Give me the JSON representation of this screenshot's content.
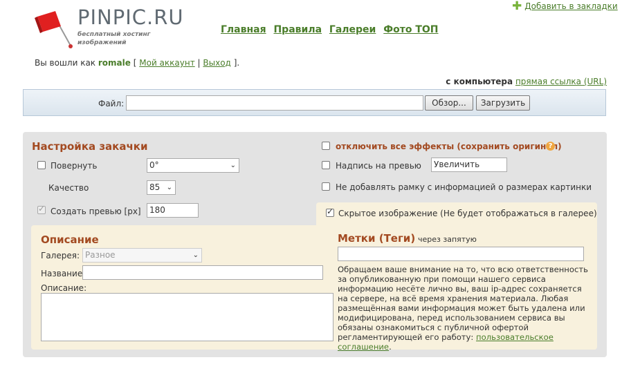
{
  "header": {
    "logo_text": "PINPIC.RU",
    "logo_tagline": "бесплатный хостинг изображений",
    "bookmark_label": "Добавить в закладки",
    "nav": [
      "Главная",
      "Правила",
      "Галереи",
      "Фото ТОП"
    ]
  },
  "session": {
    "prefix": "Вы вошли как",
    "username": "romale",
    "open_bracket": "[",
    "account_link": "Мой аккаунт",
    "separator": "|",
    "logout_link": "Выход",
    "close_bracket": "]."
  },
  "source": {
    "current": "с компьютера",
    "url_link": "прямая ссылка (URL)"
  },
  "upload": {
    "file_label": "Файл:",
    "file_value": "",
    "browse_label": "Обзор...",
    "upload_label": "Загрузить"
  },
  "settings": {
    "title": "Настройка закачки",
    "rotate_label": "Повернуть",
    "rotate_value": "0°",
    "rotate_checked": false,
    "quality_label": "Качество",
    "quality_value": "85",
    "preview_label": "Создать превью [px]",
    "preview_value": "180",
    "preview_checked": true,
    "disable_effects_label": "отключить все эффекты (сохранить оригинал)",
    "caption_label": "Надпись на превью",
    "caption_value": "Увеличить",
    "no_frame_label": "Не добавлять рамку с информацией о размерах картинки",
    "hidden_label": "Скрытое изображение (Не будет отображаться в галерее)",
    "hidden_checked": true
  },
  "description": {
    "title": "Описание",
    "gallery_label": "Галерея:",
    "gallery_value": "Разное",
    "name_label": "Название:",
    "name_value": "",
    "desc_label": "Описание:",
    "desc_value": ""
  },
  "tags": {
    "title": "Метки (Теги)",
    "hint": "через запятую",
    "value": "",
    "notice": "Обращаем ваше внимание на то, что всю ответственность за опубликованную при помощи нашего сервиса информацию несёте лично вы, ваш ip-адрес сохраняется на сервере, на всё время хранения материала. Любая размещённая вами информация может быть удалена или модифицирована, перед использованием сервиса вы обязаны ознакомиться с публичной офертой регламентирующей его работу:",
    "agreement_link": "пользовательское соглашение",
    "period": "."
  },
  "colors": {
    "accent_green": "#4a7d2a",
    "heading_brown": "#a34a21",
    "panel_gray": "#e3e3e3",
    "cream": "#f8f1dd"
  }
}
